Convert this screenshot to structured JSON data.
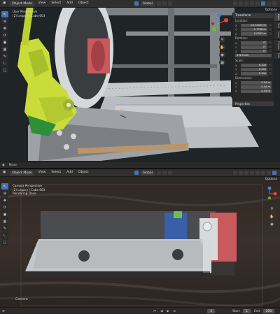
{
  "top_viewport": {
    "header": {
      "editor_icon": "editor-type-icon",
      "mode": "Object Mode",
      "menus": [
        "View",
        "Select",
        "Add",
        "Object"
      ],
      "orientation": "Global",
      "options": "Options"
    },
    "overlay": {
      "view_name": "User Perspective",
      "collection": "(2) Legacy | Cube.003"
    },
    "navigation": [
      "zoom-icon",
      "pan-icon",
      "camera-icon",
      "grid-icon"
    ],
    "n_panel": {
      "title": "Transform",
      "location_label": "Location:",
      "location": [
        {
          "axis": "X",
          "value": "0.172055 m"
        },
        {
          "axis": "Y",
          "value": "-1.7798 m"
        },
        {
          "axis": "Z",
          "value": "0.0003 m"
        }
      ],
      "rotation_label": "Rotation:",
      "rotation": [
        {
          "axis": "X",
          "value": "0°"
        },
        {
          "axis": "Y",
          "value": "0°"
        },
        {
          "axis": "Z",
          "value": "0°"
        }
      ],
      "rotation_mode": "XYZ Euler",
      "scale_label": "Scale:",
      "scale": [
        {
          "axis": "X",
          "value": "0.100"
        },
        {
          "axis": "Y",
          "value": "0.100"
        },
        {
          "axis": "Z",
          "value": "0.100"
        }
      ],
      "dimensions_label": "Dimensions:",
      "dimensions": [
        {
          "axis": "X",
          "value": "0.04 m"
        },
        {
          "axis": "Y",
          "value": "0.04 m"
        },
        {
          "axis": "Z",
          "value": "0.04 m"
        }
      ],
      "properties": "Properties"
    },
    "tabs": [
      "Item",
      "Tool",
      "View",
      "Create",
      "Edit"
    ],
    "status": {
      "label": "Move"
    }
  },
  "bottom_viewport": {
    "header": {
      "mode": "Object Mode",
      "menus": [
        "View",
        "Select",
        "Add",
        "Object"
      ],
      "orientation": "Global",
      "options": "Options"
    },
    "overlay": {
      "view_name": "Camera Perspective",
      "collection": "(2) Legacy | Cube.003",
      "rendering": "Rendering Done"
    },
    "camera_label": "Camera",
    "timeline": {
      "current_frame": "2",
      "start_label": "Start",
      "start": "1",
      "end_label": "End",
      "end": "250"
    }
  },
  "tools": [
    "cursor-icon",
    "select-box-icon",
    "cursor-3d-icon",
    "move-icon",
    "rotate-icon",
    "scale-icon",
    "transform-icon",
    "annotate-icon",
    "measure-icon",
    "add-cube-icon"
  ],
  "colors": {
    "accent": "#4772b3",
    "header": "#303030",
    "gizmo_x": "#e8443a",
    "gizmo_y": "#6cba3d",
    "gizmo_z": "#3e86d4"
  }
}
